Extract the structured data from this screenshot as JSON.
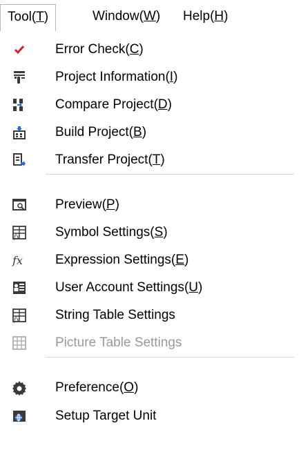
{
  "menubar": {
    "items": [
      {
        "label": "Tool",
        "mnemonic": "T",
        "active": true
      },
      {
        "label": "Window",
        "mnemonic": "W",
        "active": false
      },
      {
        "label": "Help",
        "mnemonic": "H",
        "active": false
      }
    ]
  },
  "menu": {
    "groups": [
      [
        {
          "label": "Error Check",
          "mnemonic": "C",
          "icon": "checkmark-icon",
          "disabled": false
        },
        {
          "label": "Project Information",
          "mnemonic": "I",
          "icon": "project-info-icon",
          "disabled": false
        },
        {
          "label": "Compare Project",
          "mnemonic": "D",
          "icon": "compare-icon",
          "disabled": false
        },
        {
          "label": "Build Project",
          "mnemonic": "B",
          "icon": "build-icon",
          "disabled": false
        },
        {
          "label": "Transfer Project",
          "mnemonic": "T",
          "icon": "transfer-icon",
          "disabled": false
        }
      ],
      [
        {
          "label": "Preview",
          "mnemonic": "P",
          "icon": "preview-icon",
          "disabled": false
        },
        {
          "label": "Symbol Settings",
          "mnemonic": "S",
          "icon": "symbol-table-icon",
          "disabled": false
        },
        {
          "label": "Expression Settings",
          "mnemonic": "E",
          "icon": "function-icon",
          "disabled": false
        },
        {
          "label": "User Account Settings",
          "mnemonic": "U",
          "icon": "user-account-icon",
          "disabled": false
        },
        {
          "label": "String Table Settings",
          "mnemonic": "",
          "icon": "string-table-icon",
          "disabled": false
        },
        {
          "label": "Picture Table Settings",
          "mnemonic": "",
          "icon": "picture-table-icon",
          "disabled": true
        }
      ],
      [
        {
          "label": "Preference",
          "mnemonic": "O",
          "icon": "gear-icon",
          "disabled": false
        },
        {
          "label": "Setup Target Unit",
          "mnemonic": "",
          "icon": "target-unit-icon",
          "disabled": false
        }
      ]
    ]
  },
  "colors": {
    "check_red": "#d81e2a",
    "icon_dark": "#3a3a3a",
    "icon_blue": "#1e6fd0",
    "disabled_text": "#9a9a9a",
    "separator": "#d4d4d4"
  }
}
